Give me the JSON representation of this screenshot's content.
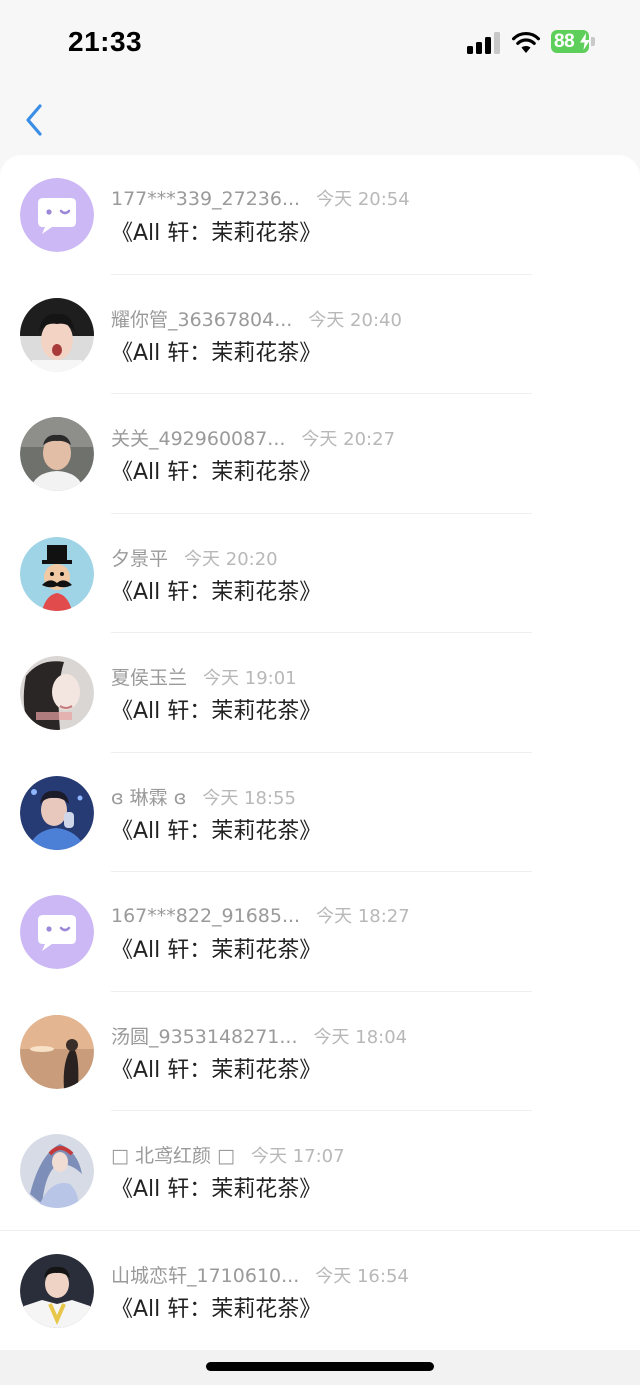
{
  "status_bar": {
    "time": "21:33",
    "battery_level": "88",
    "battery_color": "#5fcf5b"
  },
  "nav": {
    "back_icon": "chevron-left-icon",
    "accent_color": "#3a8ee6"
  },
  "messages": [
    {
      "name": "177***339_27236...",
      "time": "今天 20:54",
      "text": "《All 轩：茉莉花茶》",
      "avatar": "default-chat-avatar"
    },
    {
      "name": "耀你管_36367804...",
      "time": "今天 20:40",
      "text": "《All 轩：茉莉花茶》",
      "avatar": "photo-avatar"
    },
    {
      "name": "关关_492960087...",
      "time": "今天 20:27",
      "text": "《All 轩：茉莉花茶》",
      "avatar": "photo-avatar"
    },
    {
      "name": "夕景平",
      "time": "今天 20:20",
      "text": "《All 轩：茉莉花茶》",
      "avatar": "top-hat-mustache-avatar"
    },
    {
      "name": "夏侯玉兰",
      "time": "今天 19:01",
      "text": "《All 轩：茉莉花茶》",
      "avatar": "photo-avatar"
    },
    {
      "name": "ɞ 琳霖 ɞ",
      "time": "今天 18:55",
      "text": "《All 轩：茉莉花茶》",
      "avatar": "photo-avatar"
    },
    {
      "name": "167***822_91685...",
      "time": "今天 18:27",
      "text": "《All 轩：茉莉花茶》",
      "avatar": "default-chat-avatar"
    },
    {
      "name": "汤圆_9353148271...",
      "time": "今天 18:04",
      "text": "《All 轩：茉莉花茶》",
      "avatar": "photo-avatar"
    },
    {
      "name": "□ 北鸢红颜 □",
      "time": "今天 17:07",
      "text": "《All 轩：茉莉花茶》",
      "avatar": "photo-avatar"
    },
    {
      "name": "山城恋轩_1710610...",
      "time": "今天 16:54",
      "text": "《All 轩：茉莉花茶》",
      "avatar": "photo-avatar"
    }
  ]
}
